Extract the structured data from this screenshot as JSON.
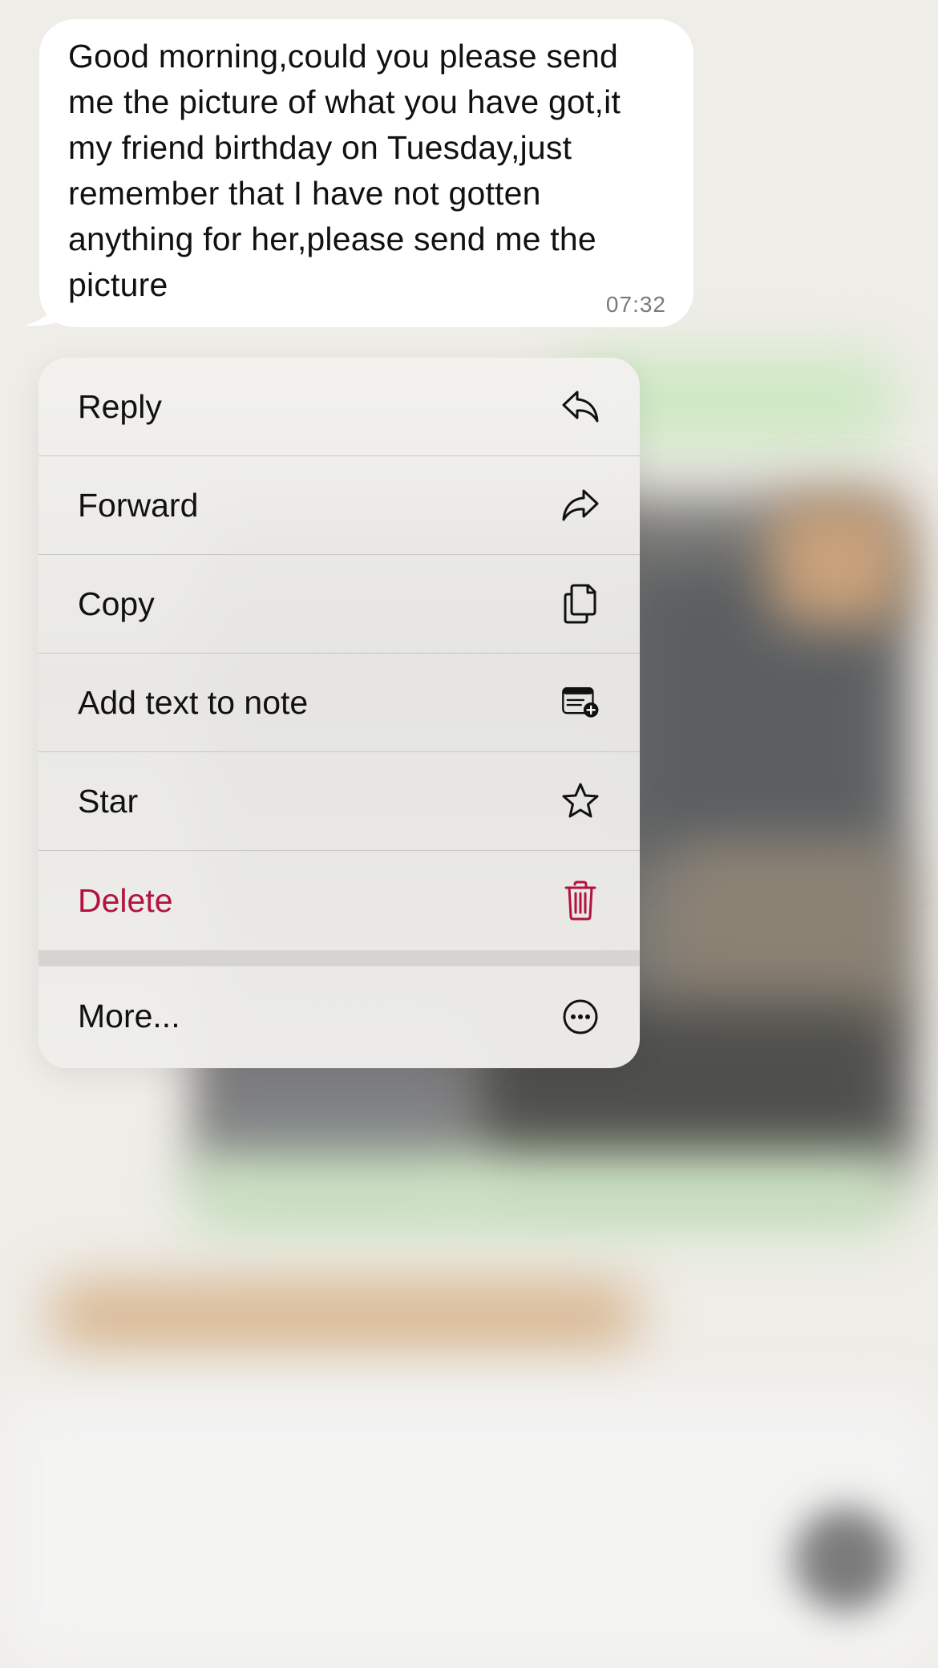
{
  "message": {
    "text": "Good morning,could you please send\nme the picture of what you have got,it\nmy friend birthday on Tuesday,just\nremember that I have not gotten\nanything for her,please send me the\npicture",
    "time": "07:32"
  },
  "menu": {
    "items": [
      {
        "label": "Reply",
        "icon": "reply-icon"
      },
      {
        "label": "Forward",
        "icon": "forward-icon"
      },
      {
        "label": "Copy",
        "icon": "copy-icon"
      },
      {
        "label": "Add text to note",
        "icon": "add-note-icon"
      },
      {
        "label": "Star",
        "icon": "star-icon"
      },
      {
        "label": "Delete",
        "icon": "trash-icon"
      }
    ],
    "more": {
      "label": "More...",
      "icon": "more-icon"
    }
  },
  "colors": {
    "destructive": "#b3123e",
    "bubble": "#ffffff",
    "background": "#efede8"
  }
}
